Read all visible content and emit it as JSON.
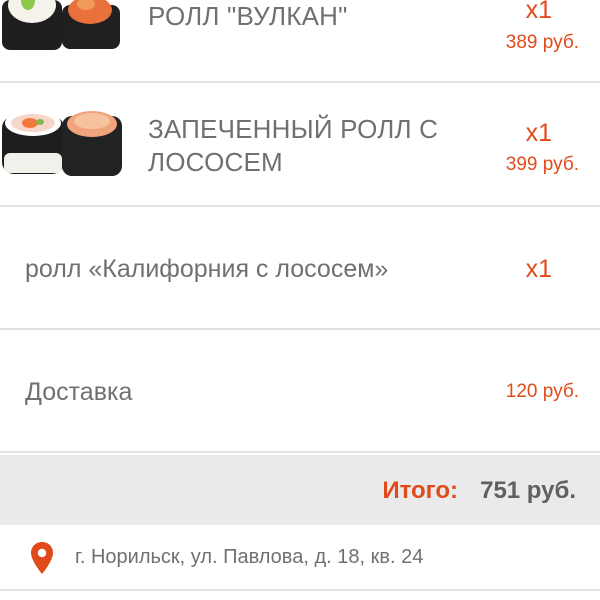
{
  "order_items": [
    {
      "name": "РОЛЛ \"ВУЛКАН\"",
      "qty": "x1",
      "price": "389 руб."
    },
    {
      "name": "ЗАПЕЧЕННЫЙ РОЛЛ С ЛОСОСЕМ",
      "qty": "x1",
      "price": "399 руб."
    },
    {
      "name": "ролл «Калифорния с лососем»",
      "qty": "x1"
    }
  ],
  "delivery": {
    "label": "Доставка",
    "price": "120 руб."
  },
  "total": {
    "label": "Итого:",
    "value": "751 руб."
  },
  "address": {
    "icon": "location-pin-icon",
    "text": "г. Норильск, ул. Павлова, д. 18, кв. 24"
  },
  "colors": {
    "accent": "#e14b1c",
    "text": "#707070",
    "total_bg": "#eaeaea"
  }
}
